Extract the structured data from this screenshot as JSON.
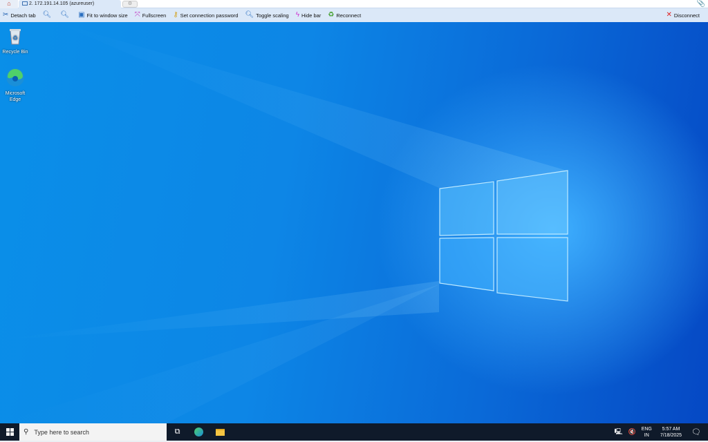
{
  "tabs": {
    "home_icon": "home-icon",
    "active_tab": "2. 172.191.14.105 (azureuser)"
  },
  "toolbar": {
    "detach": "Detach tab",
    "fit": "Fit to window size",
    "fullscreen": "Fullscreen",
    "set_password": "Set connection password",
    "toggle_scaling": "Toggle scaling",
    "hide_bar": "Hide bar",
    "reconnect": "Reconnect",
    "disconnect": "Disconnect"
  },
  "desktop": {
    "icons": [
      {
        "label": "Recycle Bin"
      },
      {
        "label": "Microsoft Edge"
      }
    ]
  },
  "taskbar": {
    "search_placeholder": "Type here to search",
    "lang_top": "ENG",
    "lang_bottom": "IN",
    "time": "5:57 AM",
    "date": "7/18/2025"
  },
  "colors": {
    "toolbar_bg": "#dbe8f8",
    "taskbar_bg": "#0f1a2a",
    "desktop_blue": "#0a7fe0"
  }
}
